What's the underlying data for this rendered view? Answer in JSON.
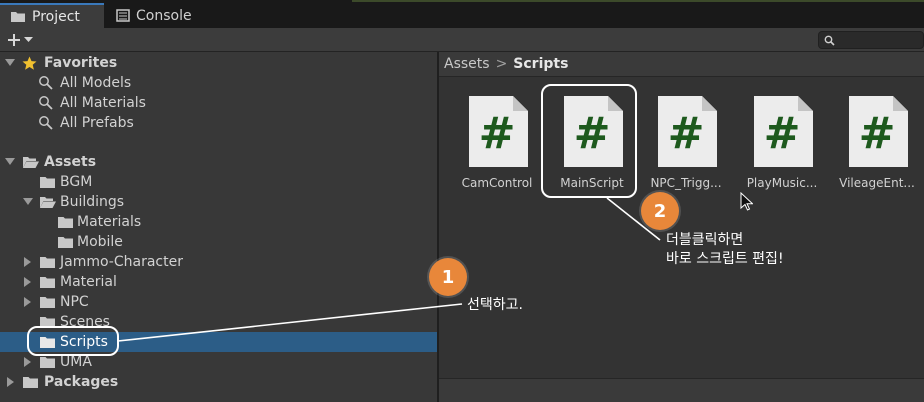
{
  "tabs": {
    "project": "Project",
    "console": "Console"
  },
  "toolbar": {
    "add_icon": "plus-icon",
    "search_placeholder": ""
  },
  "tree": {
    "favorites": {
      "label": "Favorites",
      "items": [
        "All Models",
        "All Materials",
        "All Prefabs"
      ]
    },
    "assets": {
      "label": "Assets",
      "items": [
        {
          "label": "BGM",
          "depth": 1,
          "arrow": "none"
        },
        {
          "label": "Buildings",
          "depth": 1,
          "arrow": "open"
        },
        {
          "label": "Materials",
          "depth": 2,
          "arrow": "none"
        },
        {
          "label": "Mobile",
          "depth": 2,
          "arrow": "none"
        },
        {
          "label": "Jammo-Character",
          "depth": 1,
          "arrow": "closed"
        },
        {
          "label": "Material",
          "depth": 1,
          "arrow": "closed"
        },
        {
          "label": "NPC",
          "depth": 1,
          "arrow": "closed"
        },
        {
          "label": "Scenes",
          "depth": 1,
          "arrow": "none"
        },
        {
          "label": "Scripts",
          "depth": 1,
          "arrow": "none",
          "selected": true
        },
        {
          "label": "UMA",
          "depth": 1,
          "arrow": "closed"
        }
      ]
    },
    "packages": {
      "label": "Packages"
    }
  },
  "breadcrumb": {
    "root": "Assets",
    "separator": ">",
    "current": "Scripts"
  },
  "assets_grid": [
    {
      "name": "CamControl",
      "icon": "csharp-script-icon"
    },
    {
      "name": "MainScript",
      "icon": "csharp-script-icon"
    },
    {
      "name": "NPC_Trigg...",
      "icon": "csharp-script-icon"
    },
    {
      "name": "PlayMusic...",
      "icon": "csharp-script-icon"
    },
    {
      "name": "VileageEnt...",
      "icon": "csharp-script-icon"
    }
  ],
  "annotations": {
    "step1": {
      "badge": "1",
      "text": "선택하고."
    },
    "step2": {
      "badge": "2",
      "line1": "더블클릭하면",
      "line2": "바로 스크립트 편집!"
    }
  },
  "colors": {
    "selection": "#2c5d87",
    "badge": "#e8873a",
    "script_hash": "#1e5a1e",
    "tab_accent": "#3a79bb"
  }
}
